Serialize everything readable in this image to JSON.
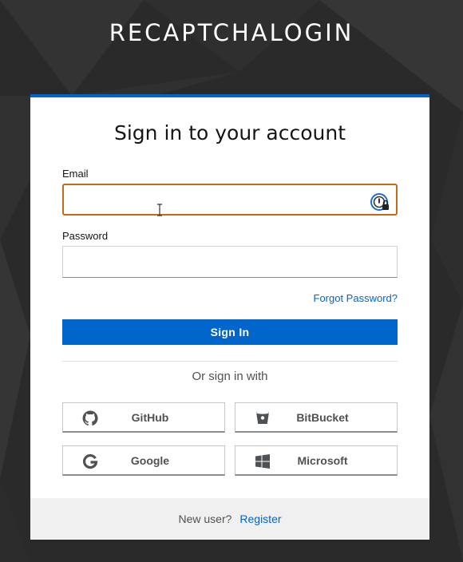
{
  "realm": {
    "title": "RECAPTCHALOGIN"
  },
  "login": {
    "heading": "Sign in to your account",
    "email_label": "Email",
    "email_value": "",
    "password_label": "Password",
    "password_value": "",
    "forgot_password": "Forgot Password?",
    "signin_button": "Sign In",
    "or_sign_in_with": "Or sign in with"
  },
  "providers": [
    {
      "label": "GitHub",
      "icon": "github-icon"
    },
    {
      "label": "BitBucket",
      "icon": "bitbucket-icon"
    },
    {
      "label": "Google",
      "icon": "google-icon"
    },
    {
      "label": "Microsoft",
      "icon": "microsoft-icon"
    }
  ],
  "footer": {
    "new_user": "New user?",
    "register": "Register"
  },
  "colors": {
    "primary": "#0066cc",
    "focus_border": "#c46a18",
    "background": "#2b2b2b"
  }
}
